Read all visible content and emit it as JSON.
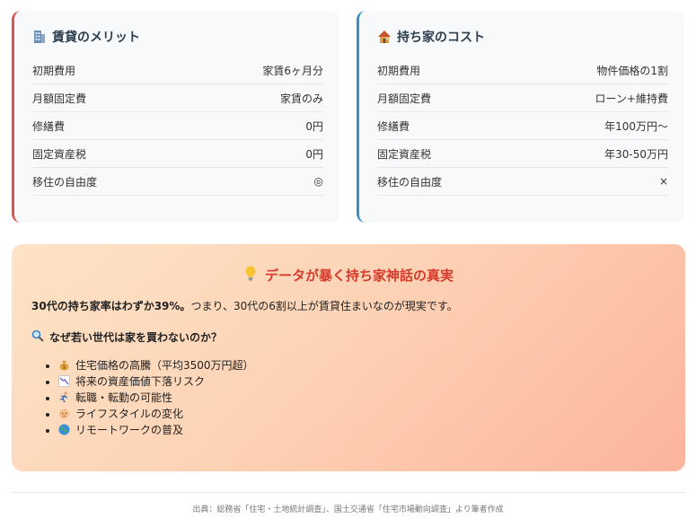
{
  "rent_card": {
    "title": "賃貸のメリット",
    "icon": "office-building-icon",
    "accent": "#d9534f",
    "rows": [
      {
        "label": "初期費用",
        "value": "家賃6ヶ月分"
      },
      {
        "label": "月額固定費",
        "value": "家賃のみ"
      },
      {
        "label": "修繕費",
        "value": "0円"
      },
      {
        "label": "固定資産税",
        "value": "0円"
      },
      {
        "label": "移住の自由度",
        "value": "◎"
      }
    ]
  },
  "own_card": {
    "title": "持ち家のコスト",
    "icon": "house-icon",
    "accent": "#3a8fc7",
    "rows": [
      {
        "label": "初期費用",
        "value": "物件価格の1割"
      },
      {
        "label": "月額固定費",
        "value": "ローン+維持費"
      },
      {
        "label": "修繕費",
        "value": "年100万円〜"
      },
      {
        "label": "固定資産税",
        "value": "年30-50万円"
      },
      {
        "label": "移住の自由度",
        "value": "×"
      }
    ]
  },
  "banner": {
    "title": "データが暴く持ち家神話の真実",
    "icon": "light-bulb-icon",
    "lead_bold": "30代の持ち家率はわずか39%。",
    "lead_rest": "つまり、30代の6割以上が賃貸住まいなのが現実です。",
    "question": "なぜ若い世代は家を買わないのか？",
    "question_icon": "magnifier-icon",
    "reasons": [
      {
        "icon": "money-bag-icon",
        "text": "住宅価格の高騰（平均3500万円超）"
      },
      {
        "icon": "chart-down-icon",
        "text": "将来の資産価値下落リスク"
      },
      {
        "icon": "running-person-icon",
        "text": "転職・転勤の可能性"
      },
      {
        "icon": "baby-icon",
        "text": "ライフスタイルの変化"
      },
      {
        "icon": "globe-icon",
        "text": "リモートワークの普及"
      }
    ],
    "title_color": "#d63a2b"
  },
  "footer": {
    "source": "出典：総務省「住宅・土地統計調査」、国土交通省「住宅市場動向調査」より筆者作成"
  }
}
